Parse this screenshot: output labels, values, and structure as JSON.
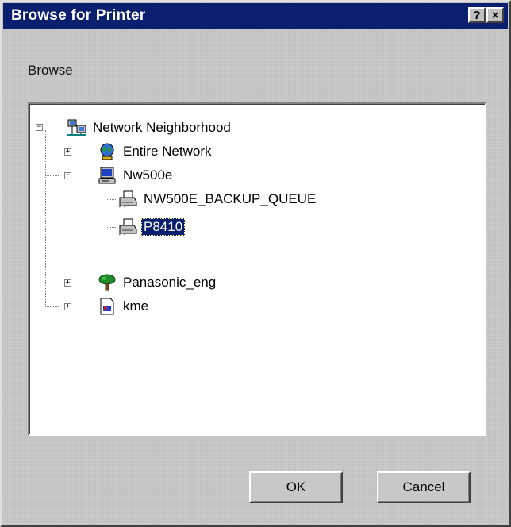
{
  "window": {
    "title": "Browse for Printer",
    "help_glyph": "?",
    "close_glyph": "×"
  },
  "browse_label": "Browse",
  "tree": {
    "items": [
      {
        "label": "Network Neighborhood",
        "icon": "network-neighborhood-icon",
        "expander": "−"
      },
      {
        "label": "Entire Network",
        "icon": "globe-network-icon",
        "expander": "+"
      },
      {
        "label": "Nw500e",
        "icon": "server-computer-icon",
        "expander": "−"
      },
      {
        "label": "NW500E_BACKUP_QUEUE",
        "icon": "printer-icon"
      },
      {
        "label": "P8410",
        "icon": "printer-icon",
        "selected": true
      },
      {
        "label": "Panasonic_eng",
        "icon": "tree-icon",
        "expander": "+"
      },
      {
        "label": "kme",
        "icon": "document-icon",
        "expander": "+"
      }
    ]
  },
  "buttons": {
    "ok_label": "OK",
    "cancel_label": "Cancel"
  },
  "colors": {
    "titlebar": "#0b1f6f",
    "selection": "#0b1f6f",
    "face": "#c0c0c0"
  }
}
